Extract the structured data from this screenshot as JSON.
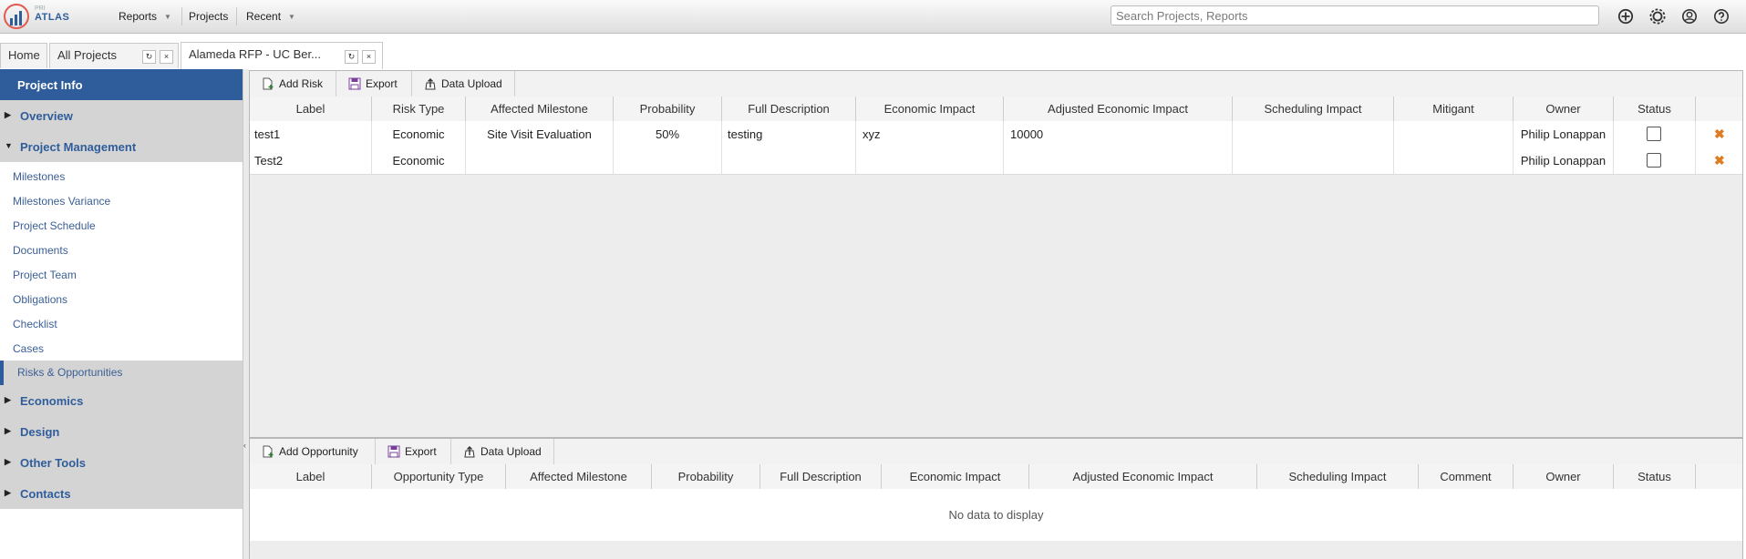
{
  "app": {
    "logo_prefix": "PRI",
    "logo_name": "ATLAS"
  },
  "topnav": {
    "reports": "Reports",
    "projects": "Projects",
    "recent": "Recent"
  },
  "search": {
    "placeholder": "Search Projects, Reports"
  },
  "tabs": [
    {
      "label": "Home"
    },
    {
      "label": "All Projects"
    },
    {
      "label": "Alameda RFP - UC Ber..."
    }
  ],
  "sidebar": {
    "header": "Project Info",
    "sections": {
      "overview": "Overview",
      "pm": "Project Management",
      "economics": "Economics",
      "design": "Design",
      "other": "Other Tools",
      "contacts": "Contacts"
    },
    "items": [
      "Milestones",
      "Milestones Variance",
      "Project Schedule",
      "Documents",
      "Project Team",
      "Obligations",
      "Checklist",
      "Cases"
    ],
    "active": "Risks & Opportunities"
  },
  "risks": {
    "toolbar": {
      "add": "Add Risk",
      "export": "Export",
      "upload": "Data Upload"
    },
    "columns": [
      "Label",
      "Risk Type",
      "Affected Milestone",
      "Probability",
      "Full Description",
      "Economic Impact",
      "Adjusted Economic Impact",
      "Scheduling Impact",
      "Mitigant",
      "Owner",
      "Status"
    ],
    "rows": [
      {
        "label": "test1",
        "type": "Economic",
        "milestone": "Site Visit Evaluation",
        "probability": "50%",
        "description": "testing",
        "econ": "xyz",
        "adj": "10000",
        "sched": "",
        "mitigant": "",
        "owner": "Philip Lonappan",
        "status": false
      },
      {
        "label": "Test2",
        "type": "Economic",
        "milestone": "",
        "probability": "",
        "description": "",
        "econ": "",
        "adj": "",
        "sched": "",
        "mitigant": "",
        "owner": "Philip Lonappan",
        "status": false
      }
    ]
  },
  "opps": {
    "toolbar": {
      "add": "Add Opportunity",
      "export": "Export",
      "upload": "Data Upload"
    },
    "columns": [
      "Label",
      "Opportunity Type",
      "Affected Milestone",
      "Probability",
      "Full Description",
      "Economic Impact",
      "Adjusted Economic Impact",
      "Scheduling Impact",
      "Comment",
      "Owner",
      "Status"
    ],
    "empty": "No data to display"
  },
  "colors": {
    "accent": "#2f5d9b",
    "delete": "#e07b22"
  }
}
